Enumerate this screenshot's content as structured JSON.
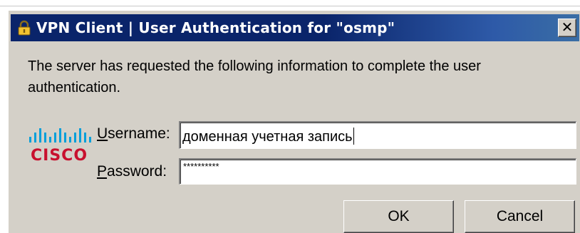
{
  "dialog": {
    "title": "VPN Client  |  User Authentication for \"osmp\"",
    "title_icon": "padlock-icon",
    "close_icon": "close-icon",
    "close_glyph": "✕",
    "message": "The server has requested the following information to complete the user authentication.",
    "logo_text": "CISCO",
    "username": {
      "label_accel": "U",
      "label_rest": "sername:",
      "value": "доменная учетная запись"
    },
    "password": {
      "label_accel": "P",
      "label_rest": "assword:",
      "masked_value": "**********"
    },
    "buttons": {
      "ok_label": "OK",
      "cancel_label": "Cancel"
    },
    "colors": {
      "titlebar": "#0a246a",
      "face": "#d4d0c8",
      "cisco_red": "#c8102e",
      "cisco_blue": "#049fd9"
    }
  }
}
